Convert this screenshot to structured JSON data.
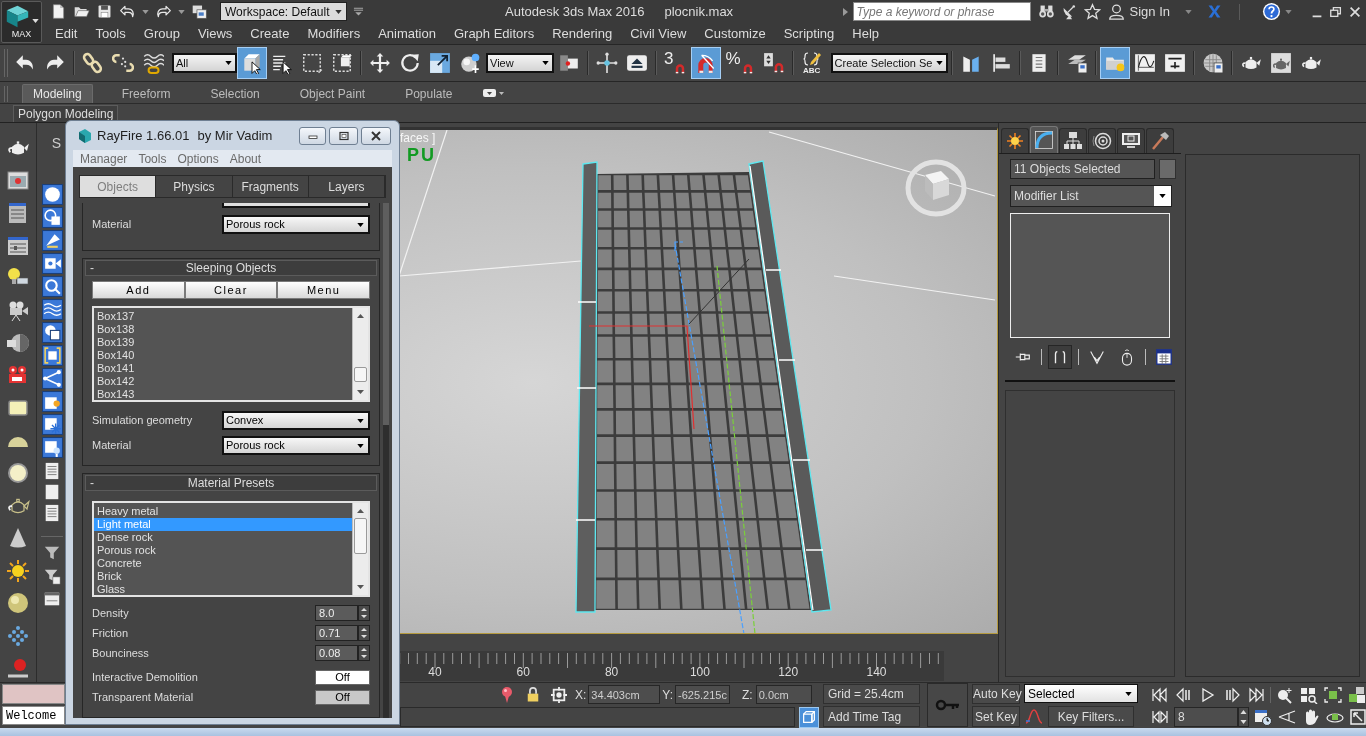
{
  "title_bar": {
    "app_button": "MAX",
    "workspace": "Workspace: Default",
    "title": "Autodesk 3ds Max 2016",
    "file": "plocnik.max",
    "search": {
      "placeholder": "Type a keyword or phrase"
    },
    "sign_in": "Sign In"
  },
  "menu_bar": [
    "Edit",
    "Tools",
    "Group",
    "Views",
    "Create",
    "Modifiers",
    "Animation",
    "Graph Editors",
    "Rendering",
    "Civil View",
    "Customize",
    "Scripting",
    "Help"
  ],
  "main_toolbar": {
    "groups": [
      [
        {
          "kind": "button",
          "selected": false
        },
        {
          "kind": "button",
          "selected": false
        }
      ],
      [
        {
          "kind": "button",
          "selected": false
        },
        {
          "kind": "button",
          "selected": false
        },
        {
          "kind": "button",
          "selected": false
        },
        {
          "kind": "dropdown",
          "value": "All"
        },
        {
          "kind": "button",
          "selected": true
        },
        {
          "kind": "button",
          "selected": false
        },
        {
          "kind": "button",
          "selected": false
        },
        {
          "kind": "button",
          "selected": false
        }
      ],
      [
        {
          "kind": "button",
          "selected": false
        },
        {
          "kind": "button",
          "selected": false
        },
        {
          "kind": "button",
          "selected": false
        },
        {
          "kind": "button",
          "selected": false
        },
        {
          "kind": "dropdown",
          "value": "View"
        },
        {
          "kind": "button",
          "selected": false
        }
      ],
      [
        {
          "kind": "button",
          "selected": false
        },
        {
          "kind": "button",
          "selected": false
        }
      ],
      [
        {
          "kind": "button",
          "label": "3",
          "selected": false
        },
        {
          "kind": "button",
          "selected": true
        },
        {
          "kind": "button",
          "label": "%",
          "selected": false
        },
        {
          "kind": "button",
          "selected": false
        }
      ],
      [
        {
          "kind": "button",
          "label": "ABC",
          "selected": false
        },
        {
          "kind": "dropdown",
          "value": "Create Selection Se"
        }
      ],
      [
        {
          "kind": "button",
          "selected": false
        },
        {
          "kind": "button",
          "selected": false
        }
      ],
      [
        {
          "kind": "button",
          "selected": false
        }
      ],
      [
        {
          "kind": "button",
          "selected": false
        }
      ],
      [
        {
          "kind": "button",
          "selected": true
        },
        {
          "kind": "button",
          "selected": false
        },
        {
          "kind": "button",
          "selected": false
        }
      ],
      [
        {
          "kind": "button",
          "selected": false
        }
      ],
      [
        {
          "kind": "button",
          "selected": false
        },
        {
          "kind": "button",
          "selected": false
        },
        {
          "kind": "button",
          "selected": false
        }
      ]
    ]
  },
  "ribbon": {
    "tabs": [
      {
        "label": "Modeling",
        "selected": true
      },
      {
        "label": "Freeform",
        "selected": false
      },
      {
        "label": "Selection",
        "selected": false
      },
      {
        "label": "Object Paint",
        "selected": false
      },
      {
        "label": "Populate",
        "selected": false
      }
    ],
    "panel": "Polygon Modeling"
  },
  "command_column": {
    "label": "S"
  },
  "viewport": {
    "shading_label": "faces ]",
    "label": "PU"
  },
  "timeline": {
    "ruler_labels": [
      "40",
      "60",
      "80",
      "100",
      "120",
      "140"
    ]
  },
  "command_panel": {
    "tabs": [
      {
        "selected": false
      },
      {
        "selected": true
      },
      {
        "selected": false
      },
      {
        "selected": false
      },
      {
        "selected": false
      },
      {
        "selected": false
      }
    ],
    "object_name": "11 Objects Selected",
    "modifier_list": "Modifier List",
    "stack_tools": [
      {
        "selected": false
      },
      {
        "selected": true
      },
      {
        "selected": false
      },
      {
        "selected": false
      },
      {
        "selected": false
      }
    ]
  },
  "rayfire": {
    "title": "RayFire 1.66.01",
    "subtitle": "by Mir Vadim",
    "menu": [
      "Manager",
      "Tools",
      "Options",
      "About"
    ],
    "tabs": [
      {
        "label": "Objects",
        "selected": true
      },
      {
        "label": "Physics",
        "selected": false
      },
      {
        "label": "Fragments",
        "selected": false
      },
      {
        "label": "Layers",
        "selected": false
      }
    ],
    "rollouts": [
      {
        "rows": [
          {
            "kind": "dropdown",
            "label": "Material",
            "value": "Porous rock"
          }
        ]
      },
      {
        "title": "Sleeping Objects",
        "toggle": "-",
        "rows": [
          {
            "kind": "buttons",
            "buttons": [
              "Add",
              "Clear",
              "Menu"
            ]
          },
          {
            "kind": "list",
            "items": [
              {
                "label": "Box137",
                "selected": false
              },
              {
                "label": "Box138",
                "selected": false
              },
              {
                "label": "Box139",
                "selected": false
              },
              {
                "label": "Box140",
                "selected": false
              },
              {
                "label": "Box141",
                "selected": false
              },
              {
                "label": "Box142",
                "selected": false
              },
              {
                "label": "Box143",
                "selected": false
              }
            ]
          },
          {
            "kind": "dropdown",
            "label": "Simulation geometry",
            "value": "Convex"
          },
          {
            "kind": "dropdown",
            "label": "Material",
            "value": "Porous rock"
          }
        ]
      },
      {
        "title": "Material Presets",
        "toggle": "-",
        "rows": [
          {
            "kind": "list",
            "items": [
              {
                "label": "Heavy metal",
                "selected": false
              },
              {
                "label": "Light metal",
                "selected": true
              },
              {
                "label": "Dense rock",
                "selected": false
              },
              {
                "label": "Porous rock",
                "selected": false
              },
              {
                "label": "Concrete",
                "selected": false
              },
              {
                "label": "Brick",
                "selected": false
              },
              {
                "label": "Glass",
                "selected": false
              }
            ]
          },
          {
            "kind": "spinner",
            "label": "Density",
            "value": "8.0"
          },
          {
            "kind": "spinner",
            "label": "Friction",
            "value": "0.71"
          },
          {
            "kind": "spinner",
            "label": "Bounciness",
            "value": "0.08"
          },
          {
            "kind": "toggle",
            "label": "Interactive Demolition",
            "value": "Off",
            "focused": true
          },
          {
            "kind": "toggle",
            "label": "Transparent Material",
            "value": "Off",
            "focused": false
          }
        ]
      }
    ]
  },
  "status_bar": {
    "listener_output": "Welcome",
    "coordinates": [
      {
        "axis": "X:",
        "value": "34.403cm"
      },
      {
        "axis": "Y:",
        "value": "-625.215c"
      },
      {
        "axis": "Z:",
        "value": "0.0cm"
      }
    ],
    "isolate_toggle": {
      "selected": true
    },
    "grid": "Grid = 25.4cm",
    "time_tag": "Add Time Tag",
    "auto_key": "Auto Key",
    "set_key": "Set Key",
    "key_target": "Selected",
    "key_filters": "Key Filters...",
    "frame": "8"
  }
}
